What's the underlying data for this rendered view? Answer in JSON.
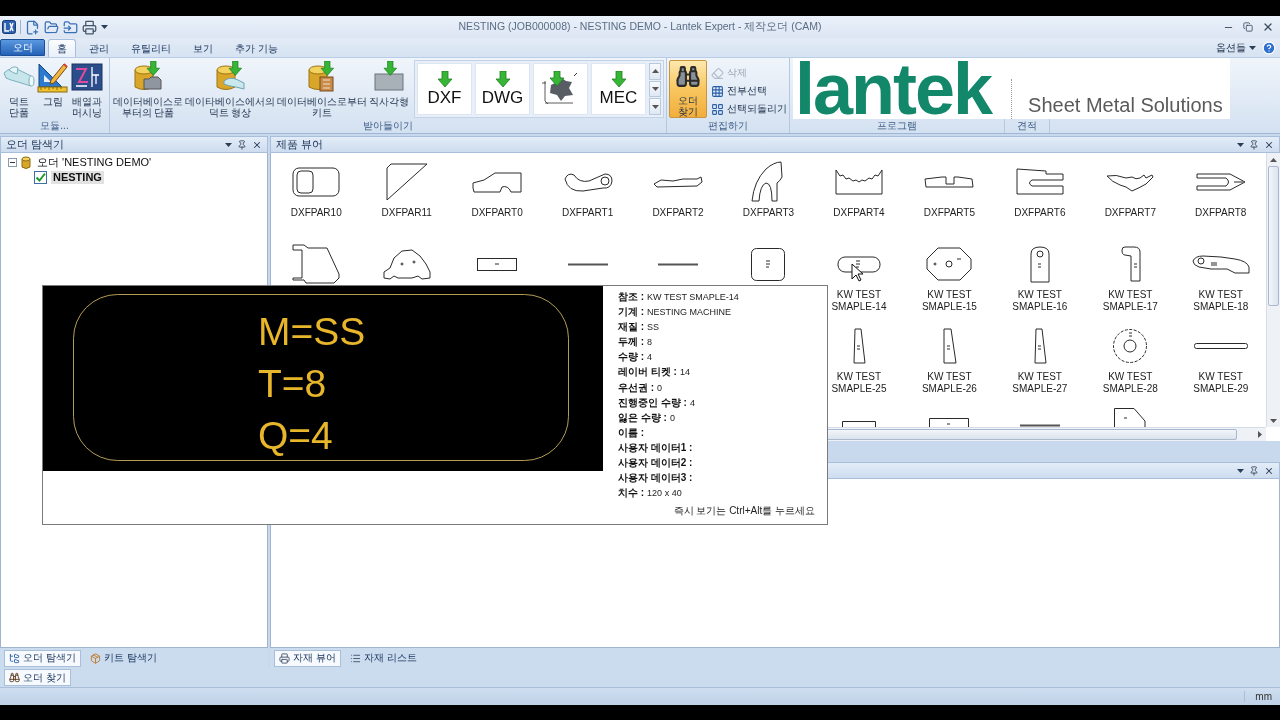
{
  "title_bar": {
    "title": "NESTING (JOB000008) - NESTING DEMO - Lantek Expert - 제작오더 (CAM)"
  },
  "ribbon": {
    "app_button": "오더",
    "tabs": [
      {
        "label": "홈",
        "selected": true
      },
      {
        "label": "관리",
        "selected": false
      },
      {
        "label": "유틸리티",
        "selected": false
      },
      {
        "label": "보기",
        "selected": false
      },
      {
        "label": "추가 기능",
        "selected": false
      }
    ],
    "options_menu": "옵션들",
    "module_group": {
      "label": "모듈...",
      "buttons": [
        "덕트\n단품",
        "그림",
        "배열과\n머시닝"
      ]
    },
    "import_group": {
      "label": "받아들이기",
      "buttons": [
        "데이터베이스로\n부터의 단품",
        "데이타베이스에서의\n덕트 형상",
        "데이터베이스로부터\n키트",
        "직사각형"
      ],
      "gallery": [
        {
          "kind": "format",
          "label": "DXF"
        },
        {
          "kind": "format",
          "label": "DWG"
        },
        {
          "kind": "drawing"
        },
        {
          "kind": "format",
          "label": "MEC"
        }
      ]
    },
    "edit_group": {
      "label": "편집하기",
      "find_button": {
        "label": "오더\n찾기",
        "highlighted": true
      },
      "commands": [
        {
          "label": "삭제",
          "disabled": true
        },
        {
          "label": "전부선택",
          "disabled": false
        },
        {
          "label": "선택되돌리기",
          "disabled": false
        }
      ]
    },
    "program_group": {
      "label": "프로그램"
    },
    "estimate_group": {
      "label": "견적"
    }
  },
  "banner": {
    "logo": "lantek",
    "tagline": "Sheet Metal Solutions"
  },
  "order_explorer": {
    "title": "오더 탐색기",
    "tree": [
      {
        "kind": "order",
        "label": "오더 'NESTING DEMO'",
        "expanded": true,
        "selected": false,
        "children": [
          {
            "kind": "job",
            "label": "NESTING",
            "checked": true,
            "selected": true
          }
        ]
      }
    ],
    "tabs": [
      {
        "label": "오더 탐색기",
        "selected": true
      },
      {
        "label": "키트 탐색기",
        "selected": false
      }
    ]
  },
  "product_viewer": {
    "title": "제품 뷰어",
    "rows": [
      {
        "cells": [
          {
            "label": "DXFPAR10"
          },
          {
            "label": "DXFPAR11"
          },
          {
            "label": "DXFPART0"
          },
          {
            "label": "DXFPART1"
          },
          {
            "label": "DXFPART2"
          },
          {
            "label": "DXFPART3"
          },
          {
            "label": "DXFPART4"
          },
          {
            "label": "DXFPART5"
          },
          {
            "label": "DXFPART6"
          },
          {
            "label": "DXFPART7"
          },
          {
            "label": "DXFPART8"
          }
        ]
      },
      {
        "cells": [
          {},
          {},
          {},
          {},
          {},
          {},
          {
            "label": "KW TEST SMAPLE-14"
          },
          {
            "label": "KW TEST SMAPLE-15"
          },
          {
            "label": "KW TEST SMAPLE-16"
          },
          {
            "label": "KW TEST SMAPLE-17"
          },
          {
            "label": "KW TEST SMAPLE-18"
          }
        ]
      },
      {
        "cells": [
          {},
          {},
          {},
          {},
          {},
          {},
          {
            "label": "KW TEST SMAPLE-25"
          },
          {
            "label": "KW TEST SMAPLE-26"
          },
          {
            "label": "KW TEST SMAPLE-27"
          },
          {
            "label": "KW TEST SMAPLE-28"
          },
          {
            "label": "KW TEST SMAPLE-29"
          }
        ]
      }
    ]
  },
  "part_tooltip": {
    "preview_lines": [
      "M=SS",
      "T=8",
      "Q=4"
    ],
    "properties": [
      {
        "label": "참조 :",
        "value": "KW TEST SMAPLE-14"
      },
      {
        "label": "기계 :",
        "value": "NESTING MACHINE"
      },
      {
        "label": "재질 :",
        "value": "SS"
      },
      {
        "label": "두께 :",
        "value": "8"
      },
      {
        "label": "수량 :",
        "value": "4"
      },
      {
        "label": "레이버 티켓 :",
        "value": "14"
      },
      {
        "label": "우선권 :",
        "value": "0"
      },
      {
        "label": "진행중인 수량 :",
        "value": "4"
      },
      {
        "label": "잃은 수량 :",
        "value": "0"
      },
      {
        "label": "이름 :"
      },
      {
        "label": "사용자 데이터1 :"
      },
      {
        "label": "사용자 데이터2 :"
      },
      {
        "label": "사용자 데이터3 :"
      },
      {
        "label": "치수 :",
        "value": "120 x 40"
      }
    ],
    "hint": "즉시 보기는 Ctrl+Alt를 누르세요"
  },
  "material_viewer": {
    "tabs": [
      {
        "label": "자재 뷰어",
        "selected": true
      },
      {
        "label": "자재 리스트",
        "selected": false
      }
    ]
  },
  "find_tabs": [
    {
      "label": "오더 찾기"
    }
  ],
  "status_bar": {
    "unit": "mm"
  }
}
